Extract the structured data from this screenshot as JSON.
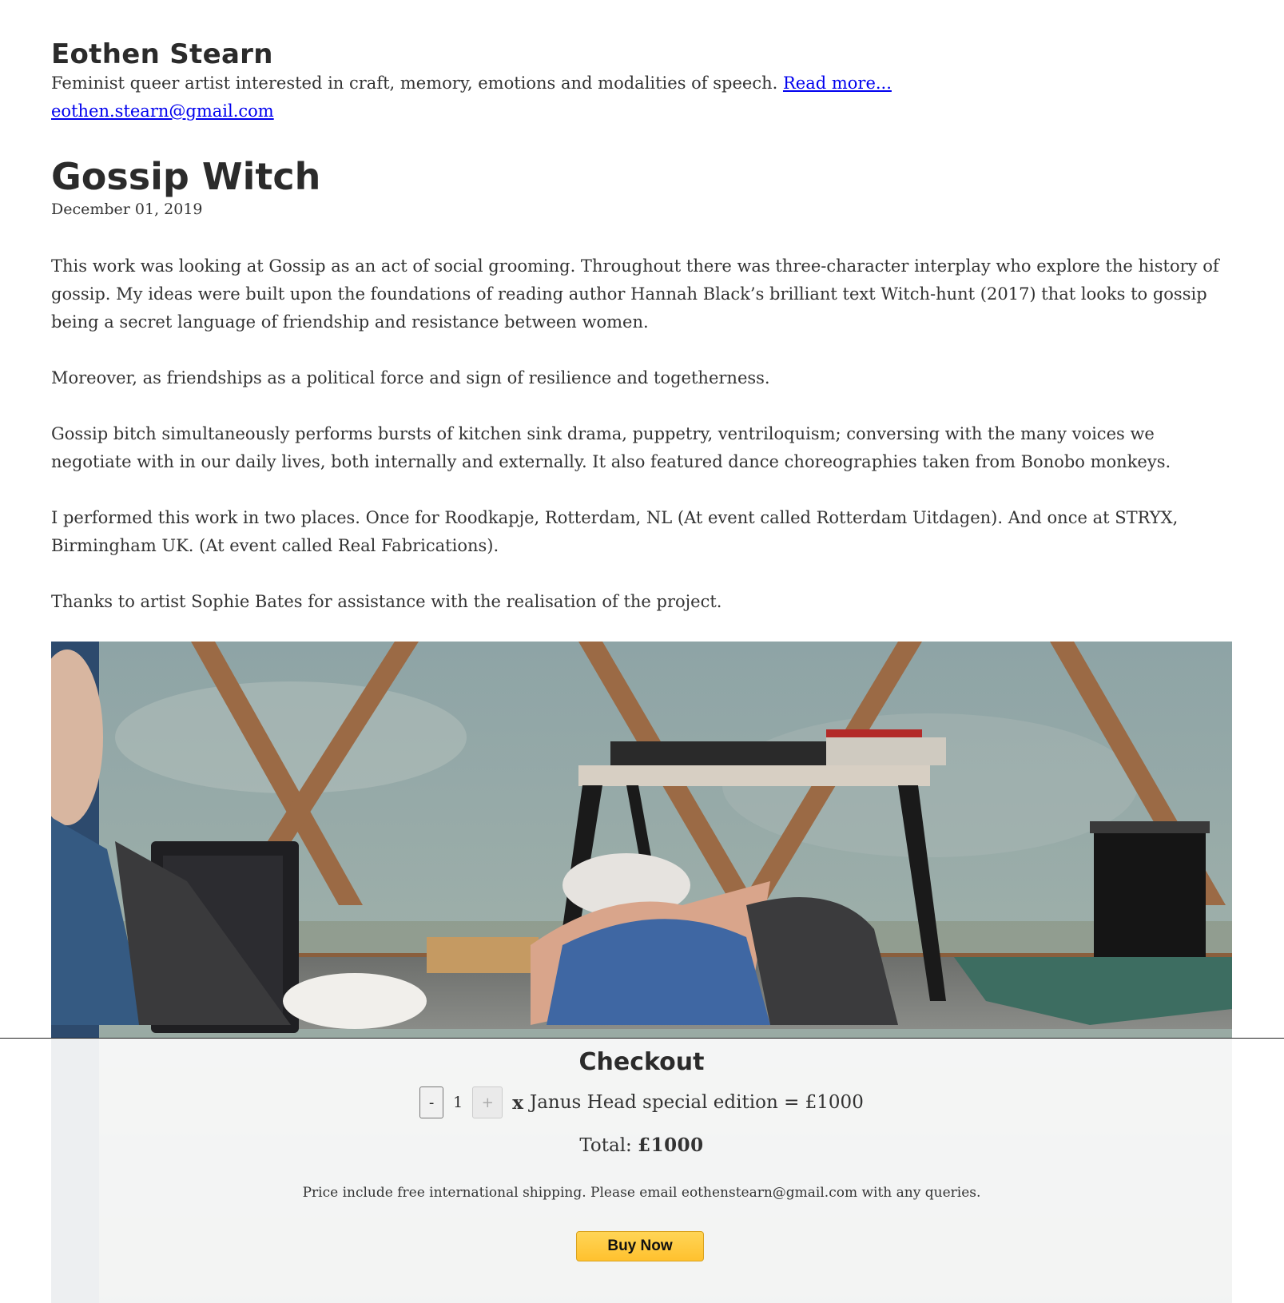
{
  "site": {
    "name": "Eothen Stearn",
    "bio": "Feminist queer artist interested in craft, memory, emotions and modalities of speech.",
    "read_more": "Read more...",
    "email": "eothen.stearn@gmail.com"
  },
  "post": {
    "title": "Gossip Witch",
    "date": "December 01, 2019",
    "paragraphs": [
      "This work was looking at Gossip as an act of social grooming. Throughout there was three-character interplay who explore the history of gossip. My ideas were built upon the foundations of reading author Hannah Black’s brilliant text Witch-hunt (2017) that looks to gossip being a secret language of friendship and resistance between women.",
      "Moreover, as friendships as a political force and sign of resilience and togetherness.",
      "Gossip bitch simultaneously performs bursts of kitchen sink drama, puppetry, ventriloquism; conversing with the many voices we negotiate with in our daily lives, both internally and externally. It also featured dance choreographies taken from Bonobo monkeys.",
      "I performed this work in two places. Once for Roodkapje, Rotterdam, NL (At event called Rotterdam Uitdagen). And once at STRYX, Birmingham UK. (At event called Real Fabrications).",
      "Thanks to artist Sophie Bates for assistance with the realisation of the project."
    ]
  },
  "checkout": {
    "title": "Checkout",
    "minus_label": "-",
    "quantity": "1",
    "plus_label": "+",
    "times": "x",
    "line_item": "Janus Head special edition = £1000",
    "total_label": "Total:",
    "total_value": "£1000",
    "shipping_note": "Price include free international shipping. Please email eothenstearn@gmail.com with any queries.",
    "buy_label": "Buy Now"
  },
  "icons": [
    "photo-performance-image"
  ],
  "colors": {
    "link": "#0000ee",
    "buy_button": "#ffc439",
    "text": "#333333"
  }
}
